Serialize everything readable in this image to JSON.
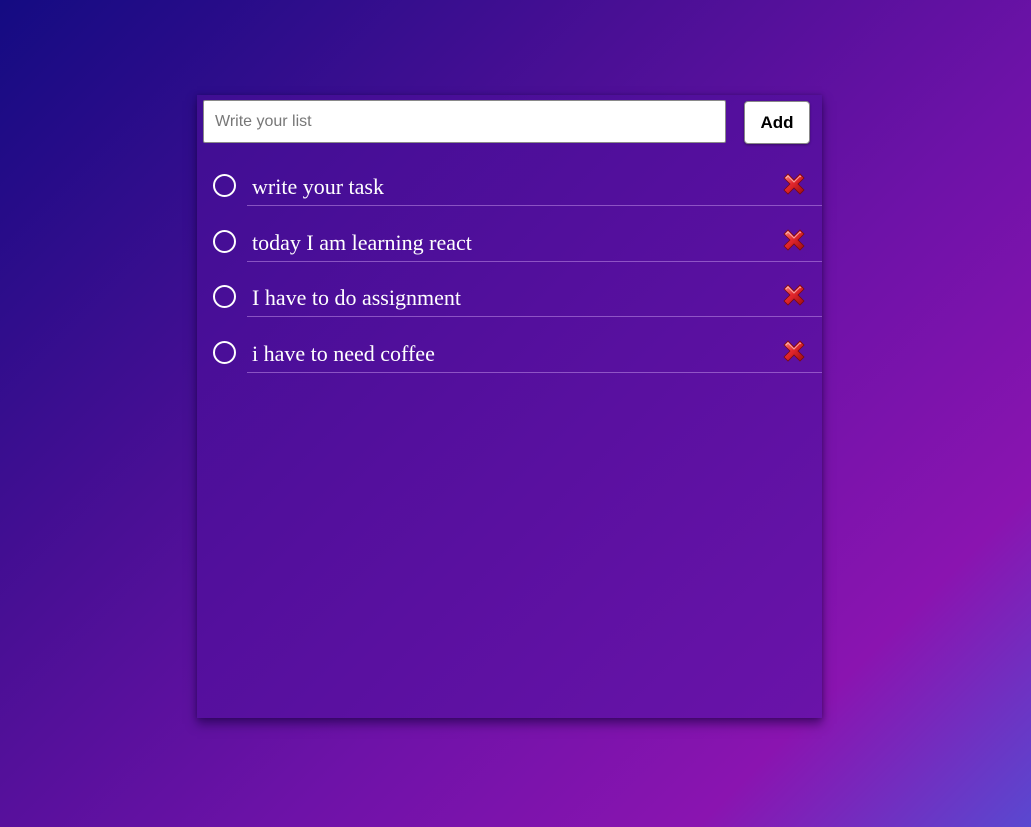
{
  "input": {
    "placeholder": "Write your list",
    "value": ""
  },
  "add_button": {
    "label": "Add"
  },
  "tasks": [
    {
      "text": "write your task",
      "done": false,
      "delete_icon": "close-x-icon"
    },
    {
      "text": "today I am learning react",
      "done": false,
      "delete_icon": "close-x-icon"
    },
    {
      "text": "I have to do assignment",
      "done": false,
      "delete_icon": "close-x-icon"
    },
    {
      "text": "i have to need coffee",
      "done": false,
      "delete_icon": "close-x-icon"
    }
  ],
  "colors": {
    "delete_icon_red": "#d8131b",
    "text": "#ffffff",
    "checkbox_border": "#ffffff"
  }
}
